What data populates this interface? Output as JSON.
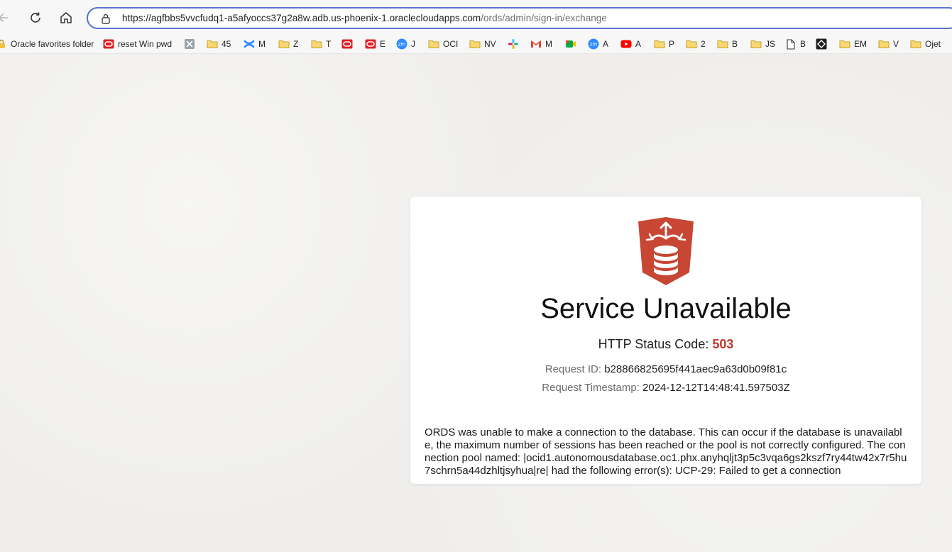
{
  "browser": {
    "url_host": "https://agfbbs5vvcfudq1-a5afyoccs37g2a8w.adb.us-phoenix-1.oraclecloudapps.com",
    "url_path": "/ords/admin/sign-in/exchange"
  },
  "bookmarks": [
    {
      "label": "Oracle favorites folder",
      "icon": "lock-icon"
    },
    {
      "label": "reset Win pwd",
      "icon": "oracle-icon"
    },
    {
      "label": "",
      "icon": "tools-icon"
    },
    {
      "label": "45",
      "icon": "folder-icon"
    },
    {
      "label": "M",
      "icon": "confluence-icon"
    },
    {
      "label": "Z",
      "icon": "folder-icon"
    },
    {
      "label": "T",
      "icon": "folder-icon"
    },
    {
      "label": "",
      "icon": "oracle-icon"
    },
    {
      "label": "E",
      "icon": "oracle-icon"
    },
    {
      "label": "J",
      "icon": "zoom-icon"
    },
    {
      "label": "OCI",
      "icon": "folder-icon"
    },
    {
      "label": "NV",
      "icon": "folder-icon"
    },
    {
      "label": "",
      "icon": "slack-icon"
    },
    {
      "label": "M",
      "icon": "gmail-icon"
    },
    {
      "label": "",
      "icon": "meet-icon"
    },
    {
      "label": "A",
      "icon": "zoom-icon"
    },
    {
      "label": "A",
      "icon": "youtube-icon"
    },
    {
      "label": "P",
      "icon": "folder-icon"
    },
    {
      "label": "2",
      "icon": "folder-icon"
    },
    {
      "label": "B",
      "icon": "folder-icon"
    },
    {
      "label": "JS",
      "icon": "folder-icon"
    },
    {
      "label": "B",
      "icon": "document-icon"
    },
    {
      "label": "",
      "icon": "dark-square-icon"
    },
    {
      "label": "EM",
      "icon": "folder-icon"
    },
    {
      "label": "V",
      "icon": "folder-icon"
    },
    {
      "label": "Ojet",
      "icon": "folder-icon"
    }
  ],
  "error": {
    "title": "Service Unavailable",
    "status_label": "HTTP Status Code:",
    "status_code": "503",
    "request_id_label": "Request ID:",
    "request_id": "b28866825695f441aec9a63d0b09f81c",
    "timestamp_label": "Request Timestamp:",
    "timestamp": "2024-12-12T14:48:41.597503Z",
    "message": "ORDS was unable to make a connection to the database. This can occur if the database is unavailable, the maximum number of sessions has been reached or the pool is not correctly configured. The connection pool named: |ocid1.autonomousdatabase.oc1.phx.anyhqljt3p5c3vqa6gs2kszf7ry44tw42x7r5hu7schrn5a44dzhltjsyhua|re| had the following error(s): UCP-29: Failed to get a connection"
  },
  "colors": {
    "accent": "#5b73d0",
    "status_code": "#c0392b",
    "logo": "#c74634"
  }
}
